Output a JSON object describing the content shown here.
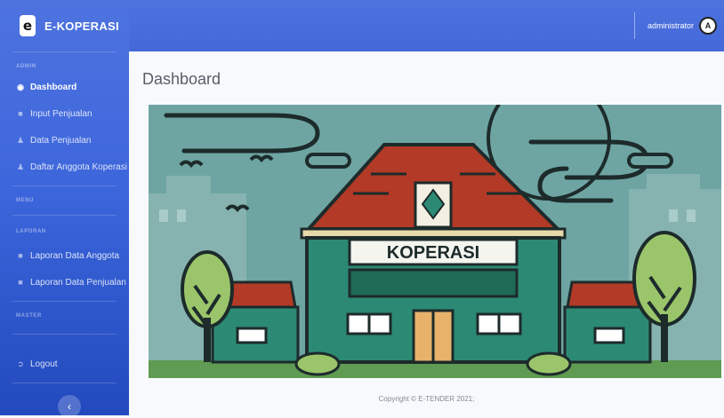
{
  "brand": {
    "logo_letter": "e",
    "name": "E-KOPERASI"
  },
  "sidebar": {
    "heading_admin": "ADMIN",
    "heading_menu": "MENU",
    "heading_laporan": "LAPORAN",
    "heading_master": "MASTER",
    "items": [
      {
        "label": "Dashboard",
        "icon": "dashboard-icon"
      },
      {
        "label": "Input Penjualan",
        "icon": "folder-icon"
      },
      {
        "label": "Data Penjualan",
        "icon": "user-icon"
      },
      {
        "label": "Daftar Anggota Koperasi",
        "icon": "user-icon"
      },
      {
        "label": "Laporan Data Anggota",
        "icon": "folder-icon"
      },
      {
        "label": "Laporan Data Penjualan",
        "icon": "folder-icon"
      },
      {
        "label": "Logout",
        "icon": "logout-icon"
      }
    ],
    "toggle_label": "‹"
  },
  "topbar": {
    "username": "administrator",
    "avatar_letter": "A"
  },
  "main": {
    "title": "Dashboard",
    "banner_text": "KOPERASI"
  },
  "footer": {
    "copyright": "Copyright © E-TENDER 2021;"
  },
  "colors": {
    "primary": "#4e73df",
    "primary_dark": "#224abe",
    "sky": "#6ea5a3",
    "roof": "#b23a26",
    "wall": "#2c8a74"
  }
}
